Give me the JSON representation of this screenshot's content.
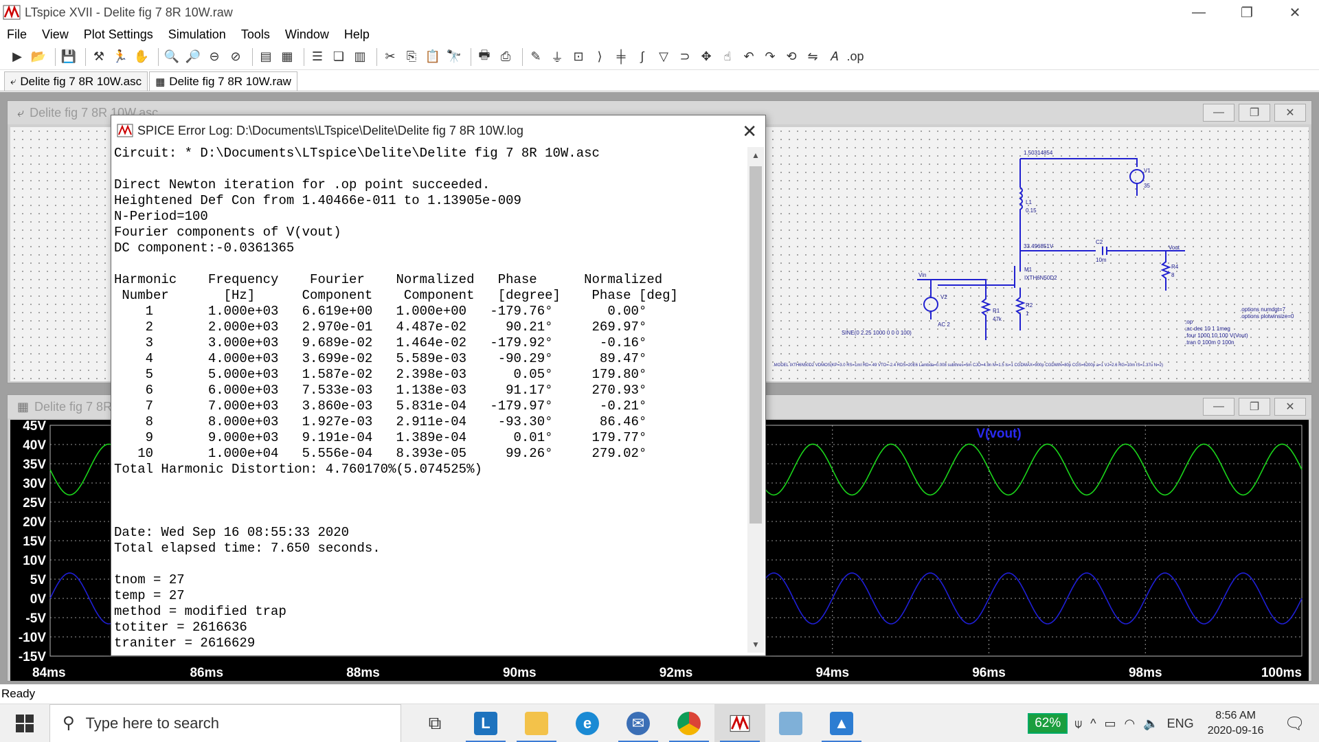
{
  "window": {
    "title": "LTspice XVII - Delite fig 7 8R 10W.raw",
    "minimize": "—",
    "restore": "❐",
    "close": "✕"
  },
  "menu": [
    "File",
    "View",
    "Plot Settings",
    "Simulation",
    "Tools",
    "Window",
    "Help"
  ],
  "tabs": [
    {
      "label": "Delite fig 7 8R 10W.asc",
      "icon": "schematic-icon",
      "active": false
    },
    {
      "label": "Delite fig 7 8R 10W.raw",
      "icon": "waveform-icon",
      "active": true
    }
  ],
  "schematic_window": {
    "title": "Delite fig 7 8R 10W.asc",
    "labels": {
      "node1": "1.50314854",
      "v1": "V1",
      "v1val": "35",
      "l1": "L1",
      "l1val": "0.15",
      "node2": "33.496851V",
      "c2": "C2",
      "c2val": "10m",
      "vout": "Vout",
      "r4": "R4",
      "r4val": "8",
      "m1": "M1",
      "m1val": "IXTH6N50D2",
      "vin": "Vin",
      "v2": "V2",
      "r1": "R1",
      "r1val": "47k",
      "r2": "R2",
      "r2val": "1",
      "ac": "AC 2",
      "sine": "SINE(0 2.25 1000 0 0 0 100)",
      "op1": ".options numdgt=7",
      "op2": ".options plotwinsize=0",
      "dir1": ";op",
      "dir2": ";ac dec 10 1 1meg",
      "dir3": ".four 1000 10 100 V(Vout)",
      "dir4": ".tran 0 100m 0 100n",
      "model": ".MODEL IXTH6N50D2 VDMOS(KP=3.0 RS=1mI RD=.49 VTO=-2.4 RDS=20E6 Lambda=0.008 subthres=5m CJO=4.9n M=1.5 Is=1 CGDMAX=900p CGDMIN=80p CGS=6200p a=1 VJ=2.6 RG=10m IS=1.37u N=2)"
    }
  },
  "waveform_window": {
    "title": "Delite fig 7 8R 10W.raw",
    "trace_label": "V(vout)",
    "colors": {
      "green": "#1bd61b",
      "blue": "#1f1fd6",
      "grid": "#9a9a9a"
    },
    "y_ticks": [
      "45V",
      "40V",
      "35V",
      "30V",
      "25V",
      "20V",
      "15V",
      "10V",
      "5V",
      "0V",
      "-5V",
      "-10V",
      "-15V"
    ],
    "x_ticks": [
      "84ms",
      "86ms",
      "88ms",
      "90ms",
      "92ms",
      "94ms",
      "96ms",
      "98ms",
      "100ms"
    ]
  },
  "chart_data": {
    "type": "line",
    "title": "V(vout)",
    "xlim": [
      84,
      100
    ],
    "ylim": [
      -15,
      45
    ],
    "x_unit": "ms",
    "y_unit": "V",
    "grid": true,
    "series": [
      {
        "name": "",
        "color": "#1bd61b",
        "offset": 33.5,
        "amplitude": 6.6,
        "frequency_hz": 1000,
        "phase_deg": -179.76
      },
      {
        "name": "",
        "color": "#1f1fd6",
        "offset": 0,
        "amplitude": 6.6,
        "frequency_hz": 1000,
        "phase_deg": 0
      }
    ]
  },
  "log_dialog": {
    "title": "SPICE Error Log: D:\\Documents\\LTspice\\Delite\\Delite fig 7 8R 10W.log",
    "close": "✕",
    "lines": [
      "Circuit: * D:\\Documents\\LTspice\\Delite\\Delite fig 7 8R 10W.asc",
      "",
      "Direct Newton iteration for .op point succeeded.",
      "Heightened Def Con from 1.40466e-011 to 1.13905e-009",
      "N-Period=100",
      "Fourier components of V(vout)",
      "DC component:-0.0361365",
      "",
      "Harmonic    Frequency    Fourier    Normalized   Phase      Normalized",
      " Number       [Hz]      Component    Component   [degree]    Phase [deg]",
      "    1       1.000e+03   6.619e+00   1.000e+00   -179.76°       0.00°",
      "    2       2.000e+03   2.970e-01   4.487e-02     90.21°     269.97°",
      "    3       3.000e+03   9.689e-02   1.464e-02   -179.92°      -0.16°",
      "    4       4.000e+03   3.699e-02   5.589e-03    -90.29°      89.47°",
      "    5       5.000e+03   1.587e-02   2.398e-03      0.05°     179.80°",
      "    6       6.000e+03   7.533e-03   1.138e-03     91.17°     270.93°",
      "    7       7.000e+03   3.860e-03   5.831e-04   -179.97°      -0.21°",
      "    8       8.000e+03   1.927e-03   2.911e-04    -93.30°      86.46°",
      "    9       9.000e+03   9.191e-04   1.389e-04      0.01°     179.77°",
      "   10       1.000e+04   5.556e-04   8.393e-05     99.26°     279.02°",
      "Total Harmonic Distortion: 4.760170%(5.074525%)",
      "",
      "",
      "",
      "Date: Wed Sep 16 08:55:33 2020",
      "Total elapsed time: 7.650 seconds.",
      "",
      "tnom = 27",
      "temp = 27",
      "method = modified trap",
      "totiter = 2616636",
      "traniter = 2616629"
    ]
  },
  "status": "Ready",
  "taskbar": {
    "search_placeholder": "Type here to search",
    "battery": "62%",
    "lang": "ENG",
    "time": "8:56 AM",
    "date": "2020-09-16"
  }
}
